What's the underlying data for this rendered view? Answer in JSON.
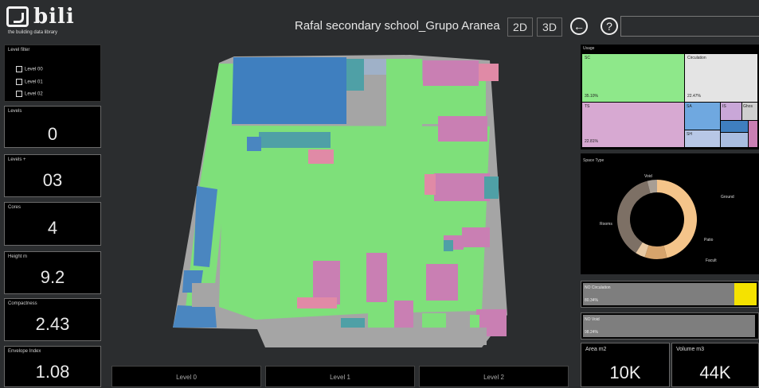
{
  "header": {
    "logo_text": "bili",
    "logo_tagline": "the building data library",
    "title": "Rafal secondary school_Grupo Aranea",
    "view_2d": "2D",
    "view_3d": "3D",
    "back_icon": "back-arrow-icon",
    "help_icon": "help-icon",
    "back_glyph": "←",
    "help_glyph": "?"
  },
  "level_filter": {
    "label": "Level filter",
    "options": [
      {
        "label": "Level 00",
        "checked": false
      },
      {
        "label": "Level 01",
        "checked": false
      },
      {
        "label": "Level 02",
        "checked": false
      }
    ]
  },
  "metrics": [
    {
      "label": "Levels",
      "value": "0"
    },
    {
      "label": "Levels +",
      "value": "03"
    },
    {
      "label": "Cores",
      "value": "4"
    },
    {
      "label": "Height m",
      "value": "9.2"
    },
    {
      "label": "Compactness",
      "value": "2.43"
    },
    {
      "label": "Envelope Index",
      "value": "1.08"
    }
  ],
  "level_buttons": [
    "Level 0",
    "Level 1",
    "Level 2"
  ],
  "treemap": {
    "title": "Usage",
    "cells": [
      {
        "label": "SC",
        "value": "35.10%",
        "color": "#8ee88a"
      },
      {
        "label": "Circulation",
        "value": "22.47%",
        "color": "#e4e4e4"
      },
      {
        "label": "TS",
        "value": "22.81%",
        "color": "#d7a9d2"
      },
      {
        "label": "SA",
        "value": "",
        "color": "#6fa8e0"
      },
      {
        "label": "IS",
        "value": "",
        "color": "#c9a7d8"
      },
      {
        "label": "Ghos",
        "value": "",
        "color": "#cfcfcf"
      },
      {
        "label": "SH",
        "value": "",
        "color": "#b7c7e6"
      }
    ]
  },
  "donut": {
    "title": "Space Type",
    "segments": [
      {
        "label": "Ground",
        "value": 46,
        "color": "#f4c48a"
      },
      {
        "label": "Patio",
        "value": 9,
        "color": "#d7a46c"
      },
      {
        "label": "Facult",
        "value": 4,
        "color": "#e8c9a4"
      },
      {
        "label": "Rooms",
        "value": 37,
        "color": "#7d7065"
      },
      {
        "label": "Void",
        "value": 4,
        "color": "#a89e94"
      }
    ]
  },
  "bars": [
    {
      "label": "NO Circulation",
      "value_text": "80.34%",
      "fraction": 0.87,
      "accent_color": "#f5e200"
    },
    {
      "label": "NO Void",
      "value_text": "98.24%",
      "fraction": 0.99,
      "accent_color": ""
    }
  ],
  "kpis": [
    {
      "label": "Area m2",
      "value": "10K"
    },
    {
      "label": "Volume m3",
      "value": "44K"
    }
  ],
  "colors": {
    "background": "#2b2d2f",
    "green": "#7ee07a",
    "blue": "#4a86c0",
    "pink": "#c97fb3",
    "teal": "#4fa0a6",
    "gray": "#a9a9a9",
    "yellow_accent": "#f5e200"
  }
}
